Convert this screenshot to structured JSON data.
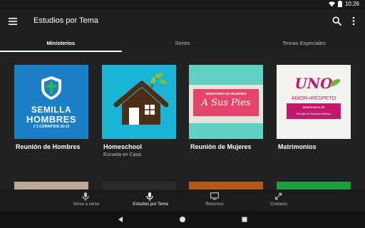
{
  "status_bar": {
    "time": "10:26"
  },
  "app_bar": {
    "title": "Estudios por Tema"
  },
  "tabs": [
    {
      "label": "Ministerios",
      "active": true
    },
    {
      "label": "Series",
      "active": false
    },
    {
      "label": "Temas Especiales",
      "active": false
    }
  ],
  "cards": [
    {
      "title": "Reunión de Hombres",
      "subtitle": "",
      "art": {
        "line1": "SEMILLA",
        "line2": "HOMBRES",
        "line3": "// 1 CORINTIOS 16:13"
      }
    },
    {
      "title": "Homeschool",
      "subtitle": "Escuela en Casa"
    },
    {
      "title": "Reunión de Mujeres",
      "subtitle": "",
      "art": {
        "line1": "MINISTERIO DE MUJERES",
        "line2": "A Sus Pies"
      }
    },
    {
      "title": "Matrimonios",
      "subtitle": "",
      "art": {
        "line1": "UNO",
        "line2": "AMOR+RESPETO",
        "line3": "Matrimonios de",
        "line4": "Semilla de Mostaza México"
      }
    }
  ],
  "bottom_nav": [
    {
      "label": "Verso a verso",
      "icon": "mic-icon",
      "active": false
    },
    {
      "label": "Estudios por Tema",
      "icon": "mic-icon",
      "active": true
    },
    {
      "label": "Recursos",
      "icon": "monitor-icon",
      "active": false
    },
    {
      "label": "Contacto",
      "icon": "arrows-icon",
      "active": false
    }
  ],
  "colors": {
    "background": "#212121",
    "card_hombres": "#1a7fc4",
    "card_homeschool": "#1bb4d6",
    "card_mujeres_bg": "#e7e4df",
    "card_mujeres_pink": "#e5456b",
    "card_matrimonios_accent": "#c2186d"
  }
}
